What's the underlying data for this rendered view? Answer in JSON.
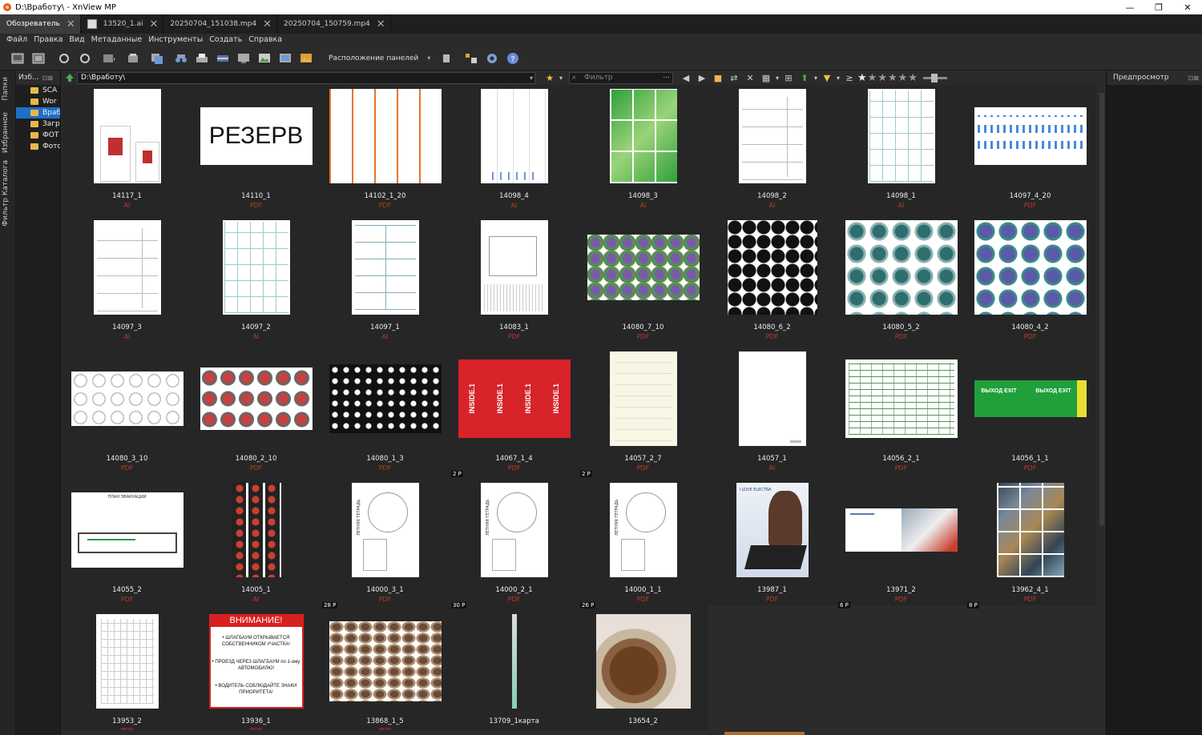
{
  "window": {
    "title": "D:\\Вработу\\ - XnView MP",
    "minimize": "—",
    "restore": "❐",
    "close": "✕"
  },
  "tabs": [
    {
      "label": "Обозреватель",
      "active": true,
      "icon": false
    },
    {
      "label": "13520_1.ai",
      "active": false,
      "icon": true
    },
    {
      "label": "20250704_151038.mp4",
      "active": false,
      "icon": false
    },
    {
      "label": "20250704_150759.mp4",
      "active": false,
      "icon": false
    }
  ],
  "menu": [
    "Файл",
    "Правка",
    "Вид",
    "Метаданные",
    "Инструменты",
    "Создать",
    "Справка"
  ],
  "toolbar": {
    "panel_layout": "Расположение панелей"
  },
  "left_tabs": [
    "Папки",
    "Избранное",
    "Фильтр Каталога"
  ],
  "folder_panel": {
    "title": "Изб...",
    "items": [
      {
        "label": "SCA",
        "selected": false
      },
      {
        "label": "Wor",
        "selected": false
      },
      {
        "label": "Враб",
        "selected": true
      },
      {
        "label": "Загр",
        "selected": false
      },
      {
        "label": "ФОТ",
        "selected": false
      },
      {
        "label": "Фото",
        "selected": false
      }
    ]
  },
  "address": {
    "path": "D:\\Вработу\\",
    "filter_placeholder": "Фильтр",
    "filter_more": "..."
  },
  "preview": {
    "title": "Предпросмотр"
  },
  "colors": {
    "accent": "#1e6fc8",
    "type_label": "#c0392b"
  },
  "files": [
    {
      "name": "14117_1",
      "type": "AI",
      "thumb": "card",
      "w": 84,
      "h": 118,
      "pages": ""
    },
    {
      "name": "14110_1",
      "type": "PDF",
      "thumb": "reserve",
      "w": 140,
      "h": 72,
      "pages": "",
      "text": "РЕЗЕРВ"
    },
    {
      "name": "14102_1_20",
      "type": "PDF",
      "thumb": "orange",
      "w": 140,
      "h": 118,
      "pages": ""
    },
    {
      "name": "14098_4",
      "type": "AI",
      "thumb": "lines",
      "w": 84,
      "h": 118,
      "pages": ""
    },
    {
      "name": "14098_3",
      "type": "AI",
      "thumb": "green",
      "w": 84,
      "h": 118,
      "pages": ""
    },
    {
      "name": "14098_2",
      "type": "AI",
      "thumb": "boxes",
      "w": 84,
      "h": 118,
      "pages": ""
    },
    {
      "name": "14098_1",
      "type": "AI",
      "thumb": "tealgrid",
      "w": 84,
      "h": 118,
      "pages": ""
    },
    {
      "name": "14097_4_20",
      "type": "PDF",
      "thumb": "blue",
      "w": 140,
      "h": 72,
      "pages": ""
    },
    {
      "name": "14097_3",
      "type": "AI",
      "thumb": "boxes",
      "w": 84,
      "h": 118,
      "pages": ""
    },
    {
      "name": "14097_2",
      "type": "AI",
      "thumb": "tealgrid",
      "w": 84,
      "h": 118,
      "pages": ""
    },
    {
      "name": "14097_1",
      "type": "AI",
      "thumb": "labels",
      "w": 84,
      "h": 118,
      "pages": ""
    },
    {
      "name": "14083_1",
      "type": "PDF",
      "thumb": "drawing",
      "w": 84,
      "h": 118,
      "pages": ""
    },
    {
      "name": "14080_7_10",
      "type": "PDF",
      "thumb": "purple",
      "w": 140,
      "h": 82,
      "pages": ""
    },
    {
      "name": "14080_6_2",
      "type": "PDF",
      "thumb": "black",
      "w": 112,
      "h": 118,
      "pages": ""
    },
    {
      "name": "14080_5_2",
      "type": "PDF",
      "thumb": "dragons",
      "w": 140,
      "h": 118,
      "pages": ""
    },
    {
      "name": "14080_4_2",
      "type": "PDF",
      "thumb": "dragons2",
      "w": 140,
      "h": 118,
      "pages": ""
    },
    {
      "name": "14080_3_10",
      "type": "PDF",
      "thumb": "outline",
      "w": 140,
      "h": 68,
      "pages": ""
    },
    {
      "name": "14080_2_10",
      "type": "PDF",
      "thumb": "redpat",
      "w": 140,
      "h": 78,
      "pages": ""
    },
    {
      "name": "14080_1_3",
      "type": "PDF",
      "thumb": "circles",
      "w": 140,
      "h": 86,
      "pages": ""
    },
    {
      "name": "14067_1_4",
      "type": "PDF",
      "thumb": "inside",
      "w": 140,
      "h": 98,
      "pages": "2 P",
      "text": "INSIDE.1"
    },
    {
      "name": "14057_2_7",
      "type": "PDF",
      "thumb": "cream",
      "w": 84,
      "h": 118,
      "pages": "2 P"
    },
    {
      "name": "14057_1",
      "type": "AI",
      "thumb": "blank",
      "w": 84,
      "h": 118,
      "pages": ""
    },
    {
      "name": "14056_2_1",
      "type": "PDF",
      "thumb": "table",
      "w": 140,
      "h": 98,
      "pages": ""
    },
    {
      "name": "14056_1_1",
      "type": "PDF",
      "thumb": "exit",
      "w": 140,
      "h": 46,
      "pages": "",
      "text": "ВЫХОД EXIT"
    },
    {
      "name": "14055_2",
      "type": "PDF",
      "thumb": "plan",
      "w": 140,
      "h": 94,
      "pages": "",
      "text": "ПЛАН ЭВАКУАЦИИ"
    },
    {
      "name": "14005_1",
      "type": "AI",
      "thumb": "strips",
      "w": 62,
      "h": 118,
      "pages": ""
    },
    {
      "name": "14000_3_1",
      "type": "PDF",
      "thumb": "notebook",
      "w": 84,
      "h": 118,
      "pages": "28 P",
      "text": "ЛЕТНЯЯ ТЕТРАДЬ"
    },
    {
      "name": "14000_2_1",
      "type": "PDF",
      "thumb": "notebook",
      "w": 84,
      "h": 118,
      "pages": "30 P",
      "text": "ЛЕТНЯЯ ТЕТРАДЬ"
    },
    {
      "name": "14000_1_1",
      "type": "PDF",
      "thumb": "notebook",
      "w": 84,
      "h": 118,
      "pages": "26 P",
      "text": "ЛЕТНЯЯ ТЕТРАДЬ"
    },
    {
      "name": "13987_1",
      "type": "PDF",
      "thumb": "electra",
      "w": 90,
      "h": 118,
      "pages": "",
      "text": "I LOVE ELECTRA"
    },
    {
      "name": "13971_2",
      "type": "PDF",
      "thumb": "letter",
      "w": 140,
      "h": 54,
      "pages": "6 P"
    },
    {
      "name": "13962_4_1",
      "type": "PDF",
      "thumb": "collage",
      "w": 84,
      "h": 118,
      "pages": "8 P"
    },
    {
      "name": "13953_2",
      "type": "PDF",
      "thumb": "smallgrid",
      "w": 78,
      "h": 118,
      "pages": ""
    },
    {
      "name": "13936_1",
      "type": "PDF",
      "thumb": "warning",
      "w": 118,
      "h": 118,
      "pages": "",
      "text": "ВНИМАНИЕ!",
      "lines": [
        "• ШЛАГБАУМ ОТКРЫВАЕТСЯ СОБСТВЕННИКОМ УЧАСТКА!",
        "• ПРОЕЗД ЧЕРЕЗ ШЛАГБАУМ по 1-ому АВТОМОБИЛЮ!",
        "• ВОДИТЕЛЬ СОБЛЮДАЙТЕ ЗНАКИ ПРИОРИТЕТА!"
      ]
    },
    {
      "name": "13868_1_5",
      "type": "PDF",
      "thumb": "animals",
      "w": 140,
      "h": 100,
      "pages": ""
    },
    {
      "name": "13709_1карта",
      "type": "",
      "thumb": "thin",
      "w": 6,
      "h": 118,
      "pages": ""
    },
    {
      "name": "13654_2",
      "type": "",
      "thumb": "bread",
      "w": 118,
      "h": 118,
      "pages": ""
    }
  ]
}
